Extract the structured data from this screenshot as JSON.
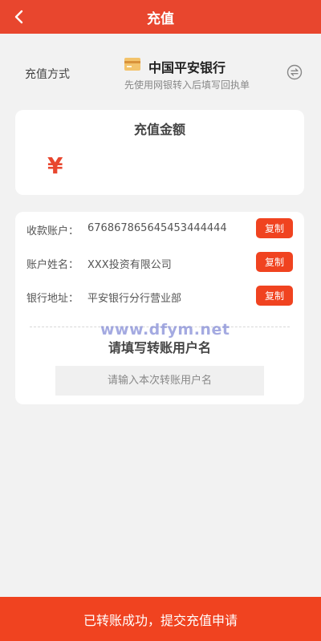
{
  "header": {
    "title": "充值"
  },
  "method": {
    "label": "充值方式",
    "bank_name": "中国平安银行",
    "hint": "先使用网银转入后填写回执单"
  },
  "amount": {
    "title": "充值金额",
    "currency_symbol": "¥"
  },
  "account_info": {
    "rows": [
      {
        "key": "收款账户：",
        "value": "676867865645453444444",
        "copy_label": "复制"
      },
      {
        "key": "账户姓名：",
        "value": "XXX投资有限公司",
        "copy_label": "复制"
      },
      {
        "key": "银行地址：",
        "value": "平安银行分行营业部",
        "copy_label": "复制"
      }
    ],
    "fill_title": "请填写转账用户名",
    "name_placeholder": "请输入本次转账用户名"
  },
  "watermark": "www.dfym.net",
  "submit_label": "已转账成功，提交充值申请",
  "colors": {
    "brand": "#e8462e",
    "button": "#f04320",
    "background": "#f2f2f2"
  },
  "icons": {
    "back": "chevron-left-icon",
    "card": "bank-card-icon",
    "switch": "switch-arrows-icon"
  }
}
